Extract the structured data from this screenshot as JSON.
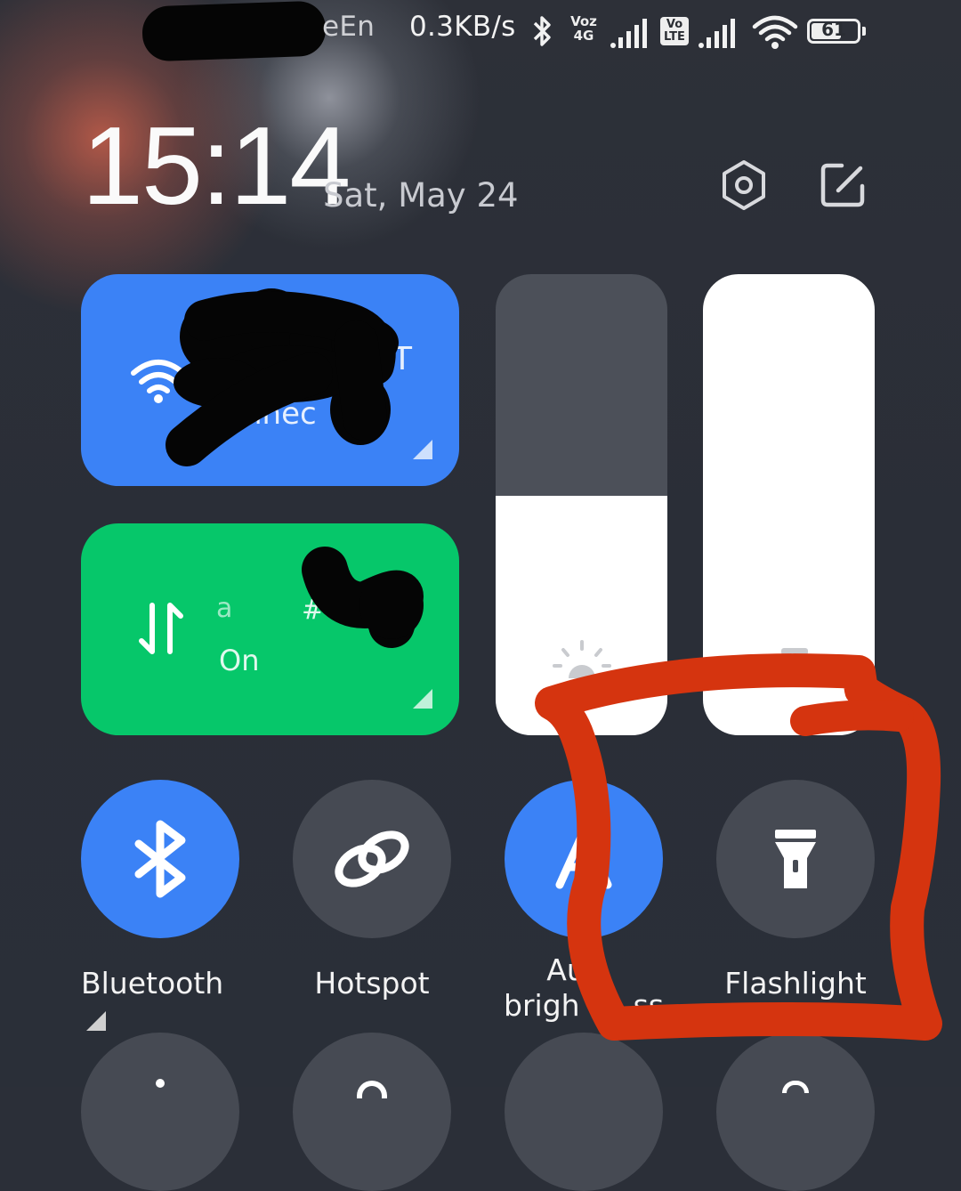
{
  "status_bar": {
    "carrier_fragment": "eEn",
    "net_speed": "0.3KB/s",
    "voz_top": "Voz",
    "voz_bottom": "4G",
    "volte_top": "Vo",
    "volte_bottom": "LTE",
    "battery": "61"
  },
  "header": {
    "time": "15:14",
    "date": "Sat, May 24"
  },
  "tiles": {
    "wifi": {
      "line1_fragment": "T",
      "line2_fragment": "nnec"
    },
    "mobile_data": {
      "name_fragment": "a",
      "number_fragment": "#",
      "status": "On"
    }
  },
  "sliders": {
    "brightness": {
      "level": 0.52
    },
    "volume": {
      "level": 1.0
    }
  },
  "toggles": [
    {
      "label": "Bluetooth",
      "state": "on",
      "icon": "bluetooth-icon"
    },
    {
      "label": "Hotspot",
      "state": "off",
      "icon": "hotspot-icon"
    },
    {
      "label_line1": "Au",
      "label_line2_a": "brigh",
      "label_line2_b": "ss",
      "state": "on",
      "icon": "auto-brightness-icon"
    },
    {
      "label": "Flashlight",
      "state": "off",
      "icon": "flashlight-icon"
    }
  ],
  "colors": {
    "accent_blue": "#3b82f6",
    "mobile_green": "#06c76a",
    "toggle_off": "#464a53",
    "annotation_red": "#d5340f"
  }
}
